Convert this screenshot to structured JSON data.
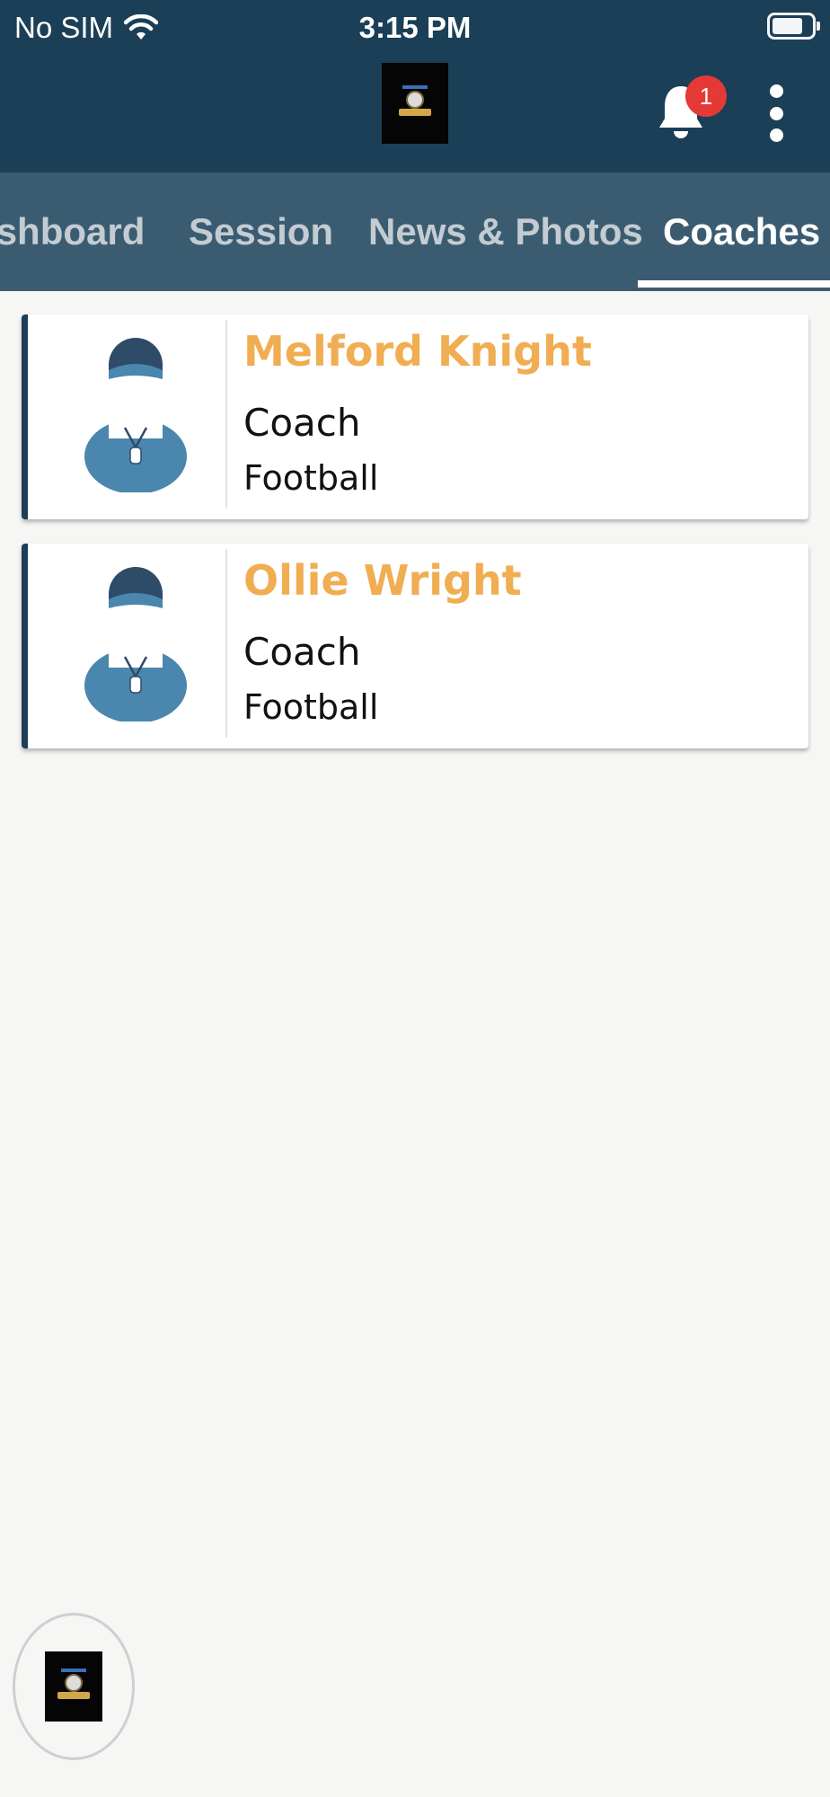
{
  "status_bar": {
    "carrier": "No SIM",
    "time": "3:15 PM",
    "wifi_icon": "wifi-icon",
    "battery_icon": "battery-icon"
  },
  "header": {
    "logo_icon": "club-logo",
    "notification_icon": "bell-icon",
    "notification_count": "1",
    "menu_icon": "more-vertical-icon",
    "background_color": "#1b3f57"
  },
  "tabs": [
    {
      "label": "Dashboard",
      "active": false
    },
    {
      "label": "Session",
      "active": false
    },
    {
      "label": "News & Photos",
      "active": false
    },
    {
      "label": "Coaches",
      "active": true
    }
  ],
  "coaches": [
    {
      "name": "Melford Knight",
      "role": "Coach",
      "sport": "Football",
      "avatar_icon": "coach-avatar-icon"
    },
    {
      "name": "Ollie Wright",
      "role": "Coach",
      "sport": "Football",
      "avatar_icon": "coach-avatar-icon"
    }
  ],
  "fab": {
    "icon": "club-logo"
  },
  "colors": {
    "accent": "#f0ad52",
    "tab_bar": "#3b5c70",
    "badge": "#e53935"
  }
}
